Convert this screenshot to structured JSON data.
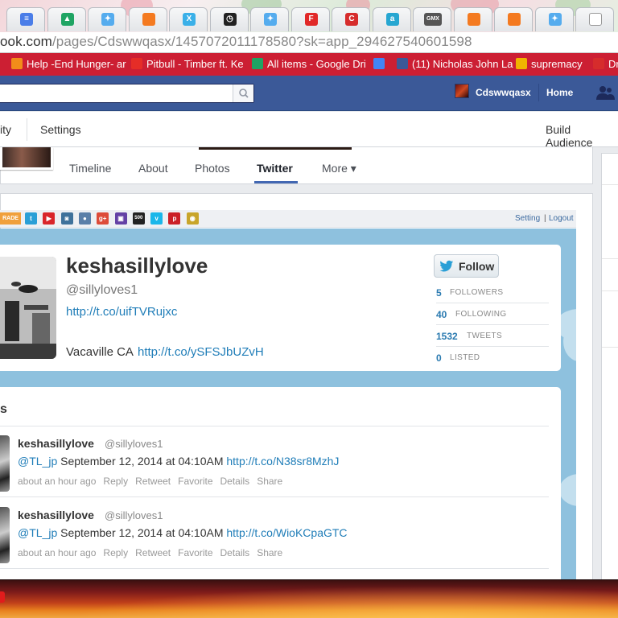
{
  "browser": {
    "url_host": "ook.com",
    "url_path": "/pages/Cdswwqasx/1457072011178580?sk=app_294627540601598",
    "tabs": [
      {
        "icon": "docs-icon",
        "color": "#4a7de8",
        "glyph": "≡"
      },
      {
        "icon": "drive-icon",
        "color": "#1fa463",
        "glyph": "▲"
      },
      {
        "icon": "twitter-icon",
        "color": "#55acee",
        "glyph": "✦"
      },
      {
        "icon": "orange-square-icon",
        "color": "#f47a20",
        "glyph": ""
      },
      {
        "icon": "xanga-icon",
        "color": "#3ab0e8",
        "glyph": "X"
      },
      {
        "icon": "clock-icon",
        "color": "#222222",
        "glyph": "◷"
      },
      {
        "icon": "twitter-icon",
        "color": "#55acee",
        "glyph": "✦"
      },
      {
        "icon": "flipboard-icon",
        "color": "#e12828",
        "glyph": "F"
      },
      {
        "icon": "c-icon",
        "color": "#d62c2c",
        "glyph": "C"
      },
      {
        "icon": "a-icon",
        "color": "#26a6d1",
        "glyph": "a"
      },
      {
        "icon": "gmx-icon",
        "color": "#555555",
        "glyph": "GMX"
      },
      {
        "icon": "orange-square-icon",
        "color": "#f47a20",
        "glyph": ""
      },
      {
        "icon": "orange-square-icon",
        "color": "#f47a20",
        "glyph": ""
      },
      {
        "icon": "twitter-icon",
        "color": "#55acee",
        "glyph": "✦"
      },
      {
        "icon": "blank-page-icon",
        "color": "#ffffff",
        "glyph": ""
      }
    ],
    "bookmarks": [
      {
        "label": "Help -End Hunger- ar",
        "icon": "bookmark-help-icon",
        "color": "#f28c1a"
      },
      {
        "label": "Pitbull - Timber ft. Ke",
        "icon": "youtube-icon",
        "color": "#e52d27"
      },
      {
        "label": "All items - Google Dri",
        "icon": "drive-icon",
        "color": "#1fa463"
      },
      {
        "label": "",
        "icon": "google-icon",
        "color": "#4285f4"
      },
      {
        "label": "(11) Nicholas John La",
        "icon": "facebook-icon",
        "color": "#3b5998"
      },
      {
        "label": "supremacy",
        "icon": "supremacy-icon",
        "color": "#f0b400"
      },
      {
        "label": "Dr",
        "icon": "c-bookmark-icon",
        "color": "#d62c2c"
      }
    ]
  },
  "facebook": {
    "user_name": "Cdswwqasx",
    "home_label": "Home",
    "admin": {
      "activity": "ity",
      "settings": "Settings",
      "build_audience": "Build Audience"
    },
    "page_tabs": {
      "timeline": "Timeline",
      "about": "About",
      "photos": "Photos",
      "twitter": "Twitter",
      "more": "More ▾"
    }
  },
  "app": {
    "trade_label": "RADE",
    "social_icons": [
      {
        "name": "twitter-icon",
        "color": "#2a9fd6",
        "glyph": "t"
      },
      {
        "name": "youtube-icon",
        "color": "#d9252a",
        "glyph": "▶"
      },
      {
        "name": "instagram-icon",
        "color": "#3f729b",
        "glyph": "◙"
      },
      {
        "name": "flickr-icon",
        "color": "#5a7fa8",
        "glyph": "●"
      },
      {
        "name": "google-plus-icon",
        "color": "#dd4b39",
        "glyph": "g+"
      },
      {
        "name": "twitch-icon",
        "color": "#6441a5",
        "glyph": "▣"
      },
      {
        "name": "500px-icon",
        "color": "#222222",
        "glyph": "500"
      },
      {
        "name": "vimeo-icon",
        "color": "#1ab7ea",
        "glyph": "v"
      },
      {
        "name": "pinterest-icon",
        "color": "#cb2027",
        "glyph": "p"
      },
      {
        "name": "camera-icon",
        "color": "#c8a52a",
        "glyph": "◉"
      }
    ],
    "setting_label": "Setting",
    "separator": "|",
    "logout_label": "Logout"
  },
  "profile": {
    "name": "keshasillylove",
    "handle": "@sillyloves1",
    "link": "http://t.co/uifTVRujxc",
    "location": "Vacaville CA",
    "location_link": "http://t.co/ySFSJbUZvH",
    "follow_label": "Follow",
    "stats": [
      {
        "value": "5",
        "label": "FOLLOWERS"
      },
      {
        "value": "40",
        "label": "FOLLOWING"
      },
      {
        "value": "1532",
        "label": "TWEETS"
      },
      {
        "value": "0",
        "label": "LISTED"
      }
    ]
  },
  "tweets": {
    "heading": "s",
    "items": [
      {
        "name": "keshasillylove",
        "handle": "@sillyloves1",
        "mention": "@TL_jp",
        "text": " September 12, 2014 at 04:10AM ",
        "link": "http://t.co/N38sr8MzhJ",
        "time": "about an hour ago",
        "actions": [
          "Reply",
          "Retweet",
          "Favorite",
          "Details",
          "Share"
        ]
      },
      {
        "name": "keshasillylove",
        "handle": "@sillyloves1",
        "mention": "@TL_jp",
        "text": " September 12, 2014 at 04:10AM ",
        "link": "http://t.co/WioKCpaGTC",
        "time": "about an hour ago",
        "actions": [
          "Reply",
          "Retweet",
          "Favorite",
          "Details",
          "Share"
        ]
      }
    ]
  }
}
